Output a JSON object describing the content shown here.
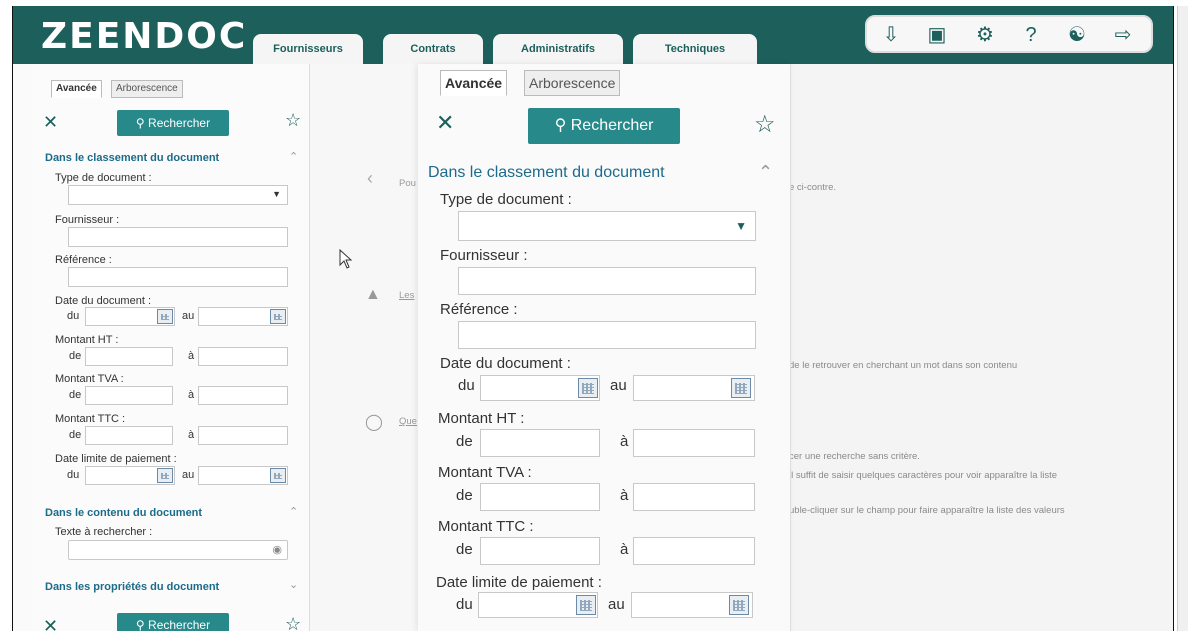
{
  "app": {
    "logo": "ZEENDOC"
  },
  "main_tabs": [
    "Fournisseurs",
    "Contrats",
    "Administratifs",
    "Techniques"
  ],
  "toolbar_icons": [
    "inbox-download-icon",
    "briefcase-icon",
    "gear-icon",
    "help-icon",
    "user-upload-icon",
    "logout-icon"
  ],
  "sidebar": {
    "tabs": {
      "advanced": "Avancée",
      "tree": "Arborescence"
    },
    "search_button": "Rechercher",
    "section_classement": "Dans le classement du document",
    "type_doc": "Type de document :",
    "fournisseur": "Fournisseur :",
    "reference": "Référence :",
    "date_doc": "Date du document :",
    "du": "du",
    "au": "au",
    "montant_ht": "Montant HT :",
    "montant_tva": "Montant TVA :",
    "montant_ttc": "Montant TTC :",
    "de": "de",
    "a": "à",
    "date_limite": "Date limite de paiement :",
    "section_contenu": "Dans le contenu du document",
    "texte": "Texte à rechercher :",
    "section_proprietes": "Dans les propriétés du document",
    "search_button_bottom": "Rechercher"
  },
  "zoom": {
    "tabs": {
      "advanced": "Avancée",
      "tree": "Arborescence"
    },
    "search_button": "Rechercher",
    "section_classement": "Dans le classement du document",
    "type_doc": "Type de document :",
    "fournisseur": "Fournisseur :",
    "reference": "Référence :",
    "date_doc": "Date du document :",
    "du": "du",
    "au": "au",
    "montant_ht": "Montant HT :",
    "montant_tva": "Montant TVA :",
    "montant_ttc": "Montant TTC :",
    "de": "de",
    "a": "à",
    "date_limite": "Date limite de paiement :"
  },
  "middle": {
    "pou": "Pou",
    "les": "Les",
    "que": "Que"
  },
  "right_help": {
    "line1": "e ci-contre.",
    "line2": "de le retrouver en cherchant un mot dans son contenu",
    "line3": "cer une recherche sans critère.",
    "line4": "il suffit de saisir quelques caractères pour voir apparaître la liste",
    "line5": "uble-cliquer sur le champ pour faire apparaître la liste des valeurs"
  }
}
